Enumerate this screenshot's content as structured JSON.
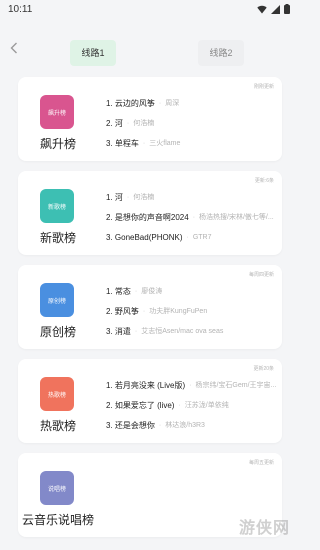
{
  "status": {
    "time": "10:11"
  },
  "tabs": {
    "active": "线路1",
    "inactive": "线路2"
  },
  "charts": [
    {
      "name": "飙升榜",
      "cover_label": "飙升榜",
      "cover_color": "#d9558f",
      "update": "刚刚更新",
      "songs": [
        {
          "title": "1. 云边的风筝",
          "artist": "周深"
        },
        {
          "title": "2. 河",
          "artist": "何浩楠"
        },
        {
          "title": "3. 单程车",
          "artist": "三火flame"
        }
      ]
    },
    {
      "name": "新歌榜",
      "cover_label": "新歌榜",
      "cover_color": "#3dbfb3",
      "update": "更新:6条",
      "songs": [
        {
          "title": "1. 河",
          "artist": "何浩楠"
        },
        {
          "title": "2. 是想你的声音啊2024",
          "artist": "杨浩热搜/宋林/傲七等/..."
        },
        {
          "title": "3. GoneBad(PHONK)",
          "artist": "GTR7"
        }
      ]
    },
    {
      "name": "原创榜",
      "cover_label": "原创榜",
      "cover_color": "#4a8fe0",
      "update": "每周四更新",
      "songs": [
        {
          "title": "1. 常态",
          "artist": "廖俊涛"
        },
        {
          "title": "2. 野风筝",
          "artist": "功夫胖KungFuPen"
        },
        {
          "title": "3. 消遣",
          "artist": "艾志恒Asen/mac ova seas"
        }
      ]
    },
    {
      "name": "热歌榜",
      "cover_label": "热歌榜",
      "cover_color": "#f0735d",
      "update": "更新20条",
      "songs": [
        {
          "title": "1. 若月亮没来 (Live版)",
          "artist": "杨宗纬/宝石Gem/王宇宙..."
        },
        {
          "title": "2. 如果爱忘了 (live)",
          "artist": "汪苏泷/单依纯"
        },
        {
          "title": "3. 还是会想你",
          "artist": "林达浪/h3R3"
        }
      ]
    },
    {
      "name": "云音乐说唱榜",
      "cover_label": "说唱榜",
      "cover_color": "#8289c9",
      "update": "每周五更新",
      "songs": []
    }
  ],
  "watermark": "游侠网"
}
